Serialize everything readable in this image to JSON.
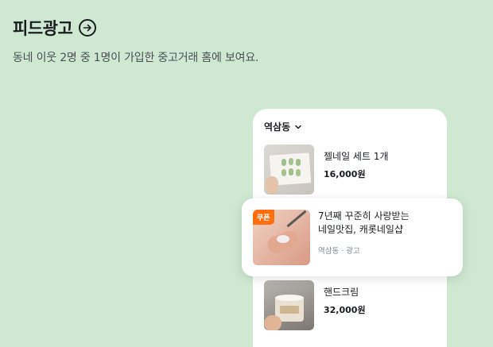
{
  "header": {
    "title": "피드광고",
    "subtitle": "동네 이웃 2명 중 1명이 가입한 중고거래 홈에 보여요."
  },
  "phone": {
    "location": "역삼동",
    "items": [
      {
        "title": "젤네일 세트 1개",
        "price": "16,000원"
      },
      {
        "title": "핸드크림",
        "price": "32,000원"
      }
    ]
  },
  "ad": {
    "badge": "쿠폰",
    "title_line1": "7년째 꾸준히 사랑받는",
    "title_line2": "네일맛집, 캐롯네일샵",
    "meta": "역삼동 · 광고"
  },
  "colors": {
    "background": "#cfe8d2",
    "accent": "#ff6f0f"
  }
}
